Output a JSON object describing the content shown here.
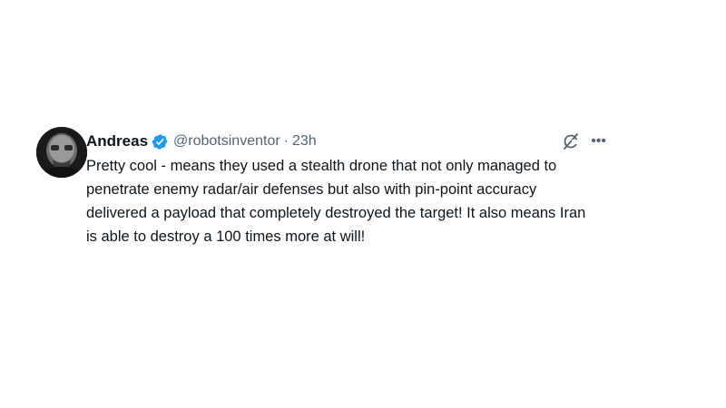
{
  "tweet": {
    "author_name": "Andreas",
    "handle": "@robotsinventor",
    "separator": "·",
    "time": "23h",
    "text": "Pretty cool - means they used a stealth drone that not only managed to penetrate enemy radar/air defenses but also with pin-point accuracy delivered a payload that completely destroyed the target! It also means Iran is able to destroy a 100 times more at will!",
    "more_label": "•••"
  },
  "icons": {
    "verified": "verified-badge-icon",
    "grok": "grok-icon",
    "more": "more-icon"
  },
  "colors": {
    "text": "#0f1419",
    "secondary": "#536471",
    "verified": "#1d9bf0"
  }
}
